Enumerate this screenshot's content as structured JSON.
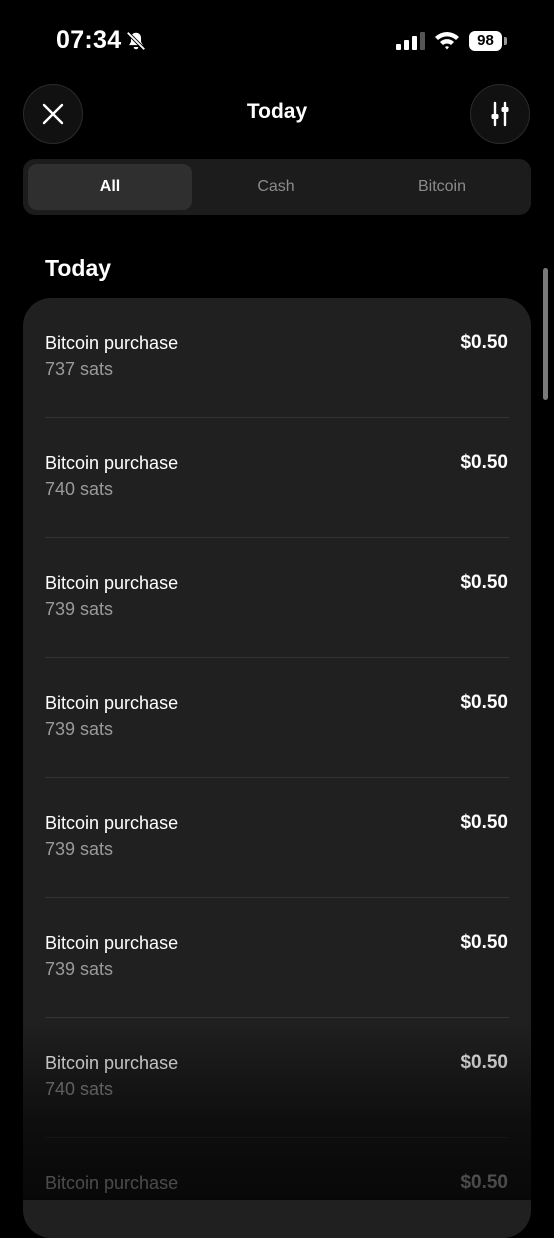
{
  "status_bar": {
    "time": "07:34",
    "battery": "98",
    "icons": [
      "bell-muted-icon",
      "signal-icon",
      "wifi-icon",
      "battery-icon"
    ]
  },
  "header": {
    "title": "Today",
    "close_icon": "close-icon",
    "filter_icon": "sliders-icon"
  },
  "tabs": [
    {
      "label": "All",
      "active": true
    },
    {
      "label": "Cash",
      "active": false
    },
    {
      "label": "Bitcoin",
      "active": false
    }
  ],
  "section": {
    "title": "Today"
  },
  "transactions": [
    {
      "title": "Bitcoin purchase",
      "subtitle": "737 sats",
      "amount": "$0.50"
    },
    {
      "title": "Bitcoin purchase",
      "subtitle": "740 sats",
      "amount": "$0.50"
    },
    {
      "title": "Bitcoin purchase",
      "subtitle": "739 sats",
      "amount": "$0.50"
    },
    {
      "title": "Bitcoin purchase",
      "subtitle": "739 sats",
      "amount": "$0.50"
    },
    {
      "title": "Bitcoin purchase",
      "subtitle": "739 sats",
      "amount": "$0.50"
    },
    {
      "title": "Bitcoin purchase",
      "subtitle": "739 sats",
      "amount": "$0.50"
    },
    {
      "title": "Bitcoin purchase",
      "subtitle": "740 sats",
      "amount": "$0.50"
    },
    {
      "title": "Bitcoin purchase",
      "subtitle": "",
      "amount": "$0.50"
    }
  ],
  "colors": {
    "background": "#000000",
    "card": "#202020",
    "segmented_bg": "#1c1c1c",
    "segment_active": "#2f2f2f",
    "muted_text": "#9a9a9a"
  }
}
